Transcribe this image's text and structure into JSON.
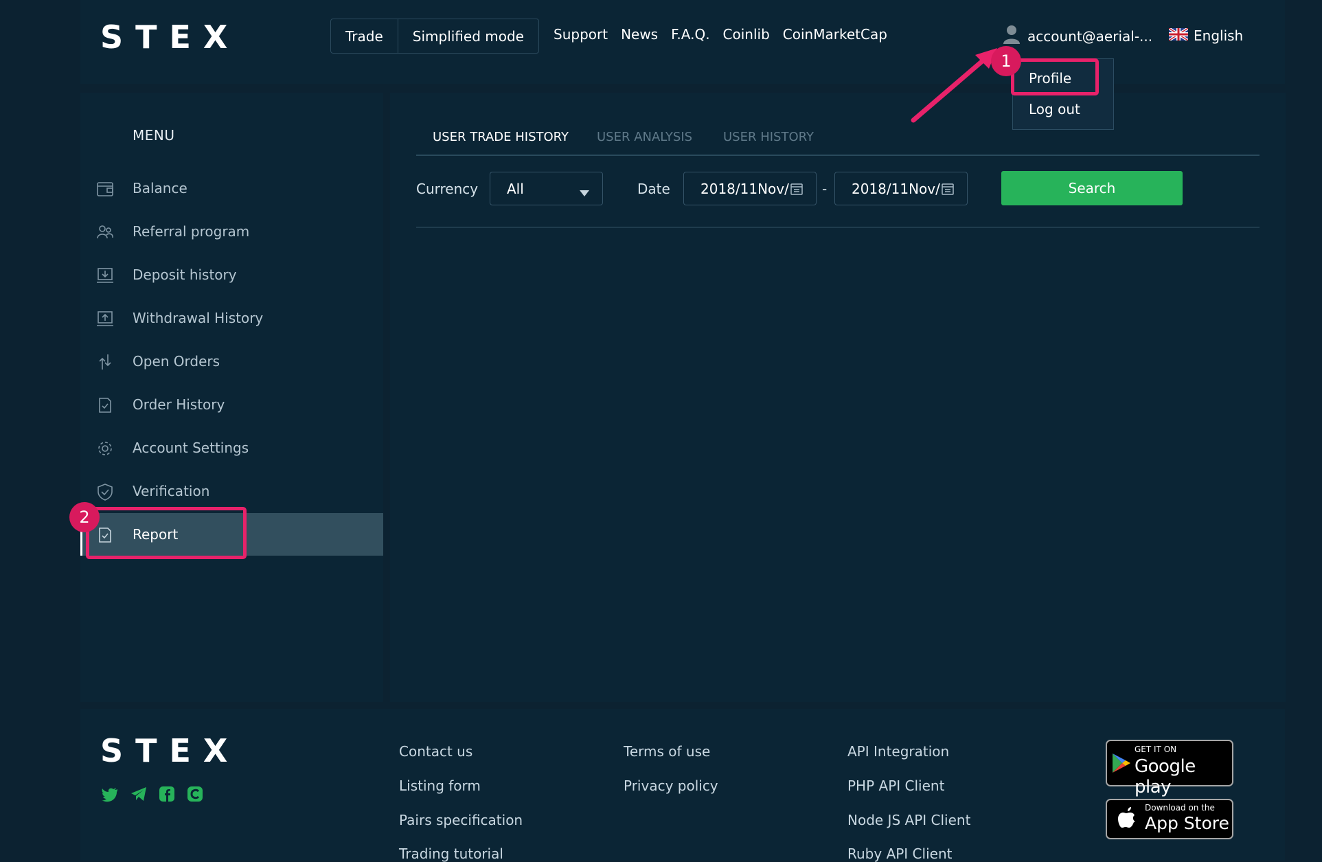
{
  "header": {
    "logo": "STEX",
    "trade_label": "Trade",
    "simplified_label": "Simplified mode",
    "nav": [
      "Support",
      "News",
      "F.A.Q.",
      "Coinlib",
      "CoinMarketCap"
    ],
    "account": "account@aerial-...",
    "language": "English"
  },
  "account_menu": {
    "items": [
      "Profile",
      "Log out"
    ]
  },
  "sidebar": {
    "title": "MENU",
    "items": [
      {
        "label": "Balance",
        "icon": "wallet-icon"
      },
      {
        "label": "Referral program",
        "icon": "people-icon"
      },
      {
        "label": "Deposit history",
        "icon": "download-icon"
      },
      {
        "label": "Withdrawal History",
        "icon": "upload-icon"
      },
      {
        "label": "Open Orders",
        "icon": "arrows-icon"
      },
      {
        "label": "Order History",
        "icon": "document-icon"
      },
      {
        "label": "Account Settings",
        "icon": "gear-icon"
      },
      {
        "label": "Verification",
        "icon": "shield-icon"
      },
      {
        "label": "Report",
        "icon": "report-icon"
      }
    ],
    "active": "Report"
  },
  "main": {
    "tabs": [
      "USER TRADE HISTORY",
      "USER ANALYSIS",
      "USER HISTORY"
    ],
    "active_tab": "USER TRADE HISTORY",
    "currency_label": "Currency",
    "currency_value": "All",
    "date_label": "Date",
    "date_from": "2018/11Nov/",
    "date_separator": "-",
    "date_to": "2018/11Nov/",
    "search_label": "Search"
  },
  "footer": {
    "logo": "STEX",
    "col1": [
      "Contact us",
      "Listing form",
      "Pairs specification",
      "Trading tutorial"
    ],
    "col2": [
      "Terms of use",
      "Privacy policy"
    ],
    "col3": [
      "API Integration",
      "PHP API Client",
      "Node JS API Client",
      "Ruby API Client"
    ],
    "google_play": {
      "small": "GET IT ON",
      "big": "Google play"
    },
    "app_store": {
      "small": "Download on the",
      "big": "App Store"
    },
    "social_icons": [
      "twitter-icon",
      "telegram-icon",
      "facebook-icon",
      "coinlib-icon"
    ]
  },
  "annotations": {
    "badge1": "1",
    "badge2": "2",
    "color": "#e8226a"
  },
  "colors": {
    "background": "#0c2231",
    "panel": "#0b2535",
    "accent_green": "#27b35a",
    "active_item": "#324f5e",
    "social_green": "#27b35a"
  }
}
